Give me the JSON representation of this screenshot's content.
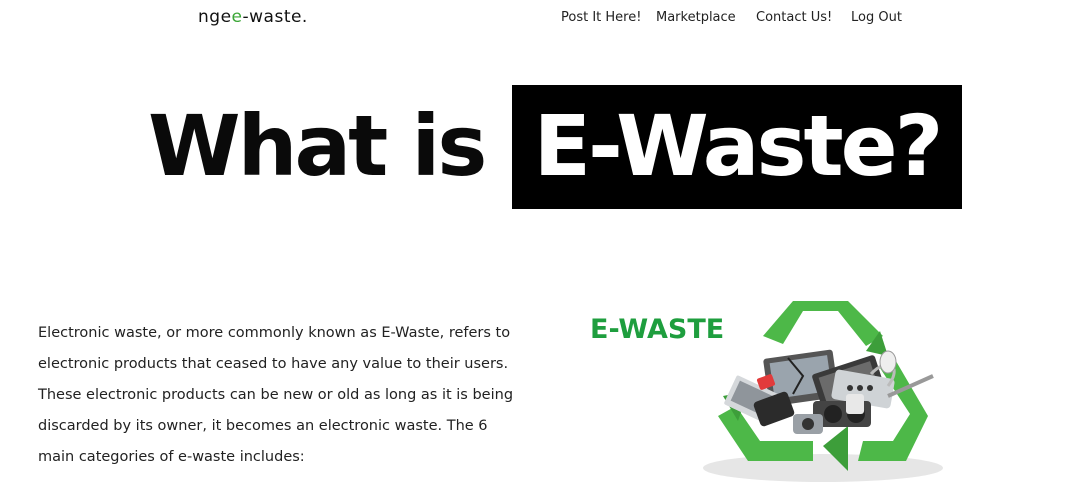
{
  "brand": {
    "prefix": "nge",
    "accent": "e",
    "suffix": "-waste."
  },
  "nav": {
    "items": [
      {
        "label": "Post It Here!"
      },
      {
        "label": "Marketplace"
      },
      {
        "label": "Contact Us!"
      },
      {
        "label": "Log Out"
      }
    ]
  },
  "hero": {
    "plain": "What is",
    "highlight": "E-Waste?"
  },
  "intro": {
    "lines": [
      "Electronic waste, or more commonly known as E-Waste, refers to",
      "electronic products that ceased to have any value to their users.",
      "These electronic products can be new or old as long as it is being",
      "discarded by its owner, it becomes an electronic waste. The 6",
      "main categories of e-waste includes:"
    ]
  },
  "illustration": {
    "caption": "E-WASTE",
    "icon": "recycle-electronics-icon"
  },
  "colors": {
    "brand_green": "#3aa635",
    "caption_green": "#1e9e3e",
    "recycle_green": "#4db848"
  }
}
